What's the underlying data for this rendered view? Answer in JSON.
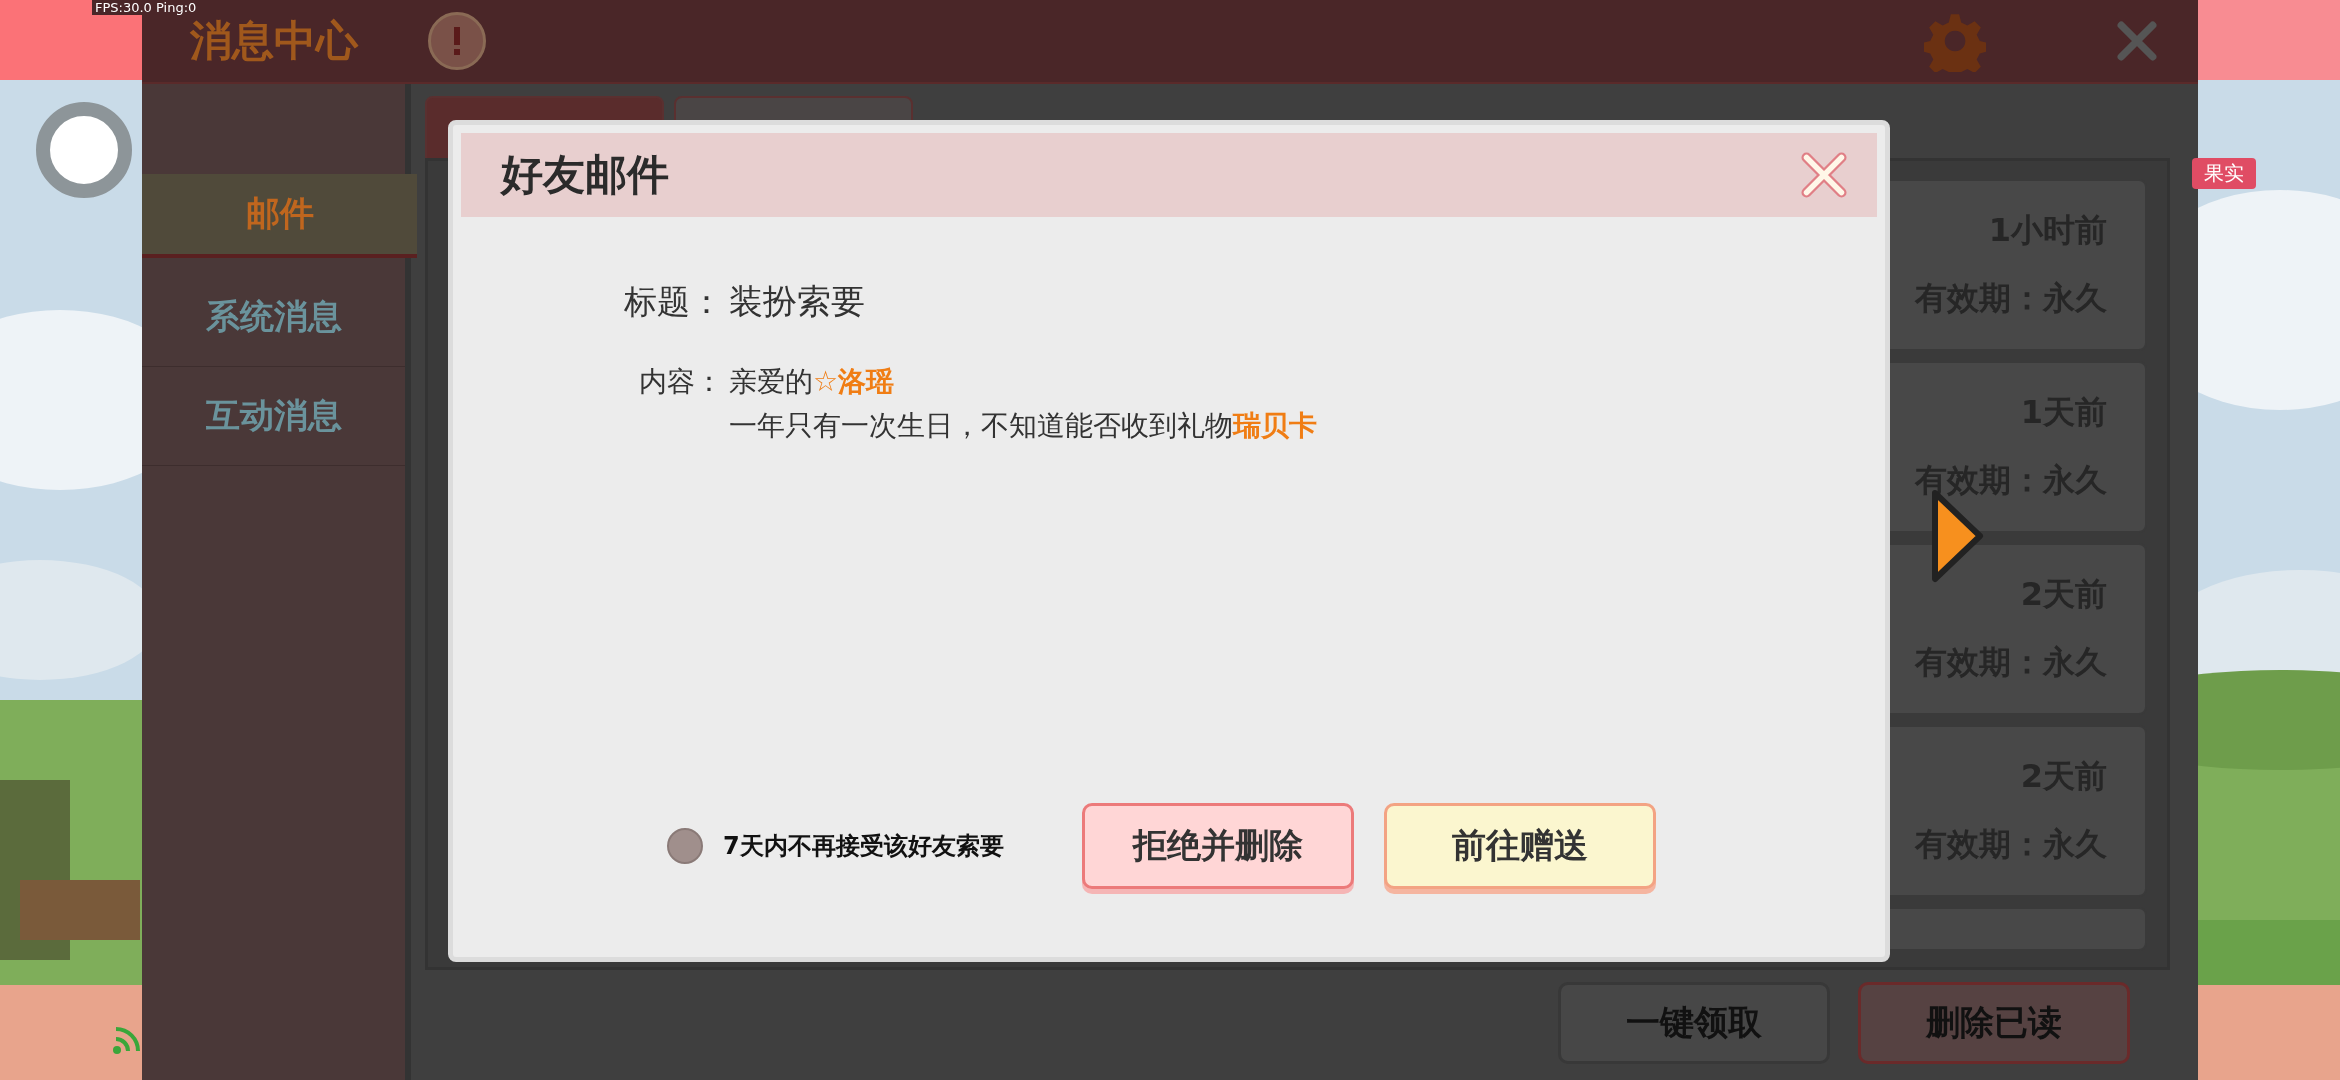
{
  "debug": {
    "text": "FPS:30.0  Ping:0"
  },
  "side_badge": {
    "label": "果实"
  },
  "header": {
    "title": "消息中心"
  },
  "sidebar": {
    "items": [
      {
        "label": "邮件",
        "selected": true
      },
      {
        "label": "系统消息",
        "selected": false
      },
      {
        "label": "互动消息",
        "selected": false
      }
    ]
  },
  "tabs": [
    {
      "selected": true
    },
    {
      "selected": false
    }
  ],
  "mail_list": [
    {
      "time": "1小时前",
      "validity": "有效期：永久"
    },
    {
      "time": "1天前",
      "validity": "有效期：永久"
    },
    {
      "time": "2天前",
      "validity": "有效期：永久"
    },
    {
      "time": "2天前",
      "validity": "有效期：永久"
    }
  ],
  "footer_buttons": [
    {
      "label": "一键领取",
      "kind": "neutral"
    },
    {
      "label": "删除已读",
      "kind": "danger"
    }
  ],
  "dialog": {
    "title": "好友邮件",
    "subject_label": "标题：",
    "subject": "装扮索要",
    "content_label": "内容：",
    "content_lines": [
      [
        {
          "text": "亲爱的",
          "kind": "plain"
        },
        {
          "text": "☆洛瑶",
          "kind": "name"
        }
      ],
      [
        {
          "text": "一年只有一次生日，不知道能否收到礼物",
          "kind": "plain"
        },
        {
          "text": "瑞贝卡",
          "kind": "name"
        }
      ]
    ],
    "option": {
      "label": "7天内不再接受该好友索要",
      "checked": false
    },
    "buttons": [
      {
        "label": "拒绝并删除",
        "kind": "reject"
      },
      {
        "label": "前往赠送",
        "kind": "confirm"
      }
    ]
  }
}
